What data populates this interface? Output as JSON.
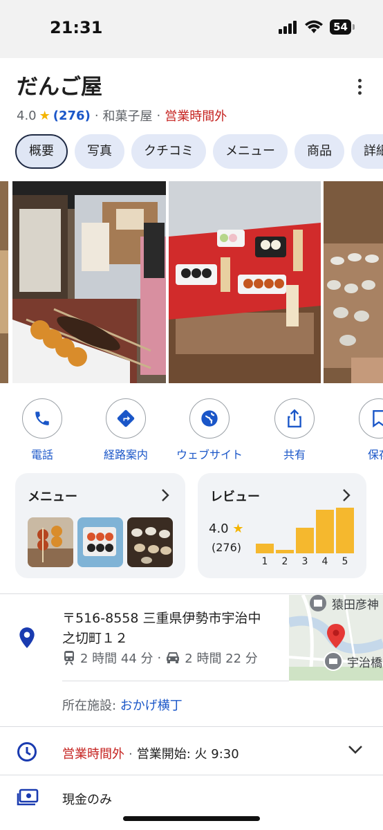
{
  "status": {
    "time": "21:31",
    "battery": "54"
  },
  "header": {
    "title": "だんご屋",
    "rating": "4.0",
    "review_count": "(276)",
    "category": "和菓子屋",
    "open_status": "営業時間外",
    "separator": "·"
  },
  "tabs": [
    "概要",
    "写真",
    "クチコミ",
    "メニュー",
    "商品",
    "詳細"
  ],
  "actions": [
    "電話",
    "経路案内",
    "ウェブサイト",
    "共有",
    "保存"
  ],
  "menu_card": {
    "title": "メニュー"
  },
  "review_card": {
    "title": "レビュー",
    "rating": "4.0",
    "count": "(276)",
    "distribution": [
      {
        "label": "1",
        "value": 0.2
      },
      {
        "label": "2",
        "value": 0.07
      },
      {
        "label": "3",
        "value": 0.55
      },
      {
        "label": "4",
        "value": 0.93
      },
      {
        "label": "5",
        "value": 0.97
      }
    ]
  },
  "address": {
    "text": "〒516-8558 三重県伊勢市宇治中之切町１２",
    "transit": "2 時間 44 分",
    "drive": "2 時間 22 分",
    "separator": "·"
  },
  "map": {
    "label_top": "猿田彦神",
    "label_bottom": "宇治橋"
  },
  "facility": {
    "label": "所在施設: ",
    "link": "おかげ横丁"
  },
  "hours": {
    "status": "営業時間外",
    "separator": "·",
    "next": "営業開始: 火 9:30"
  },
  "payment": {
    "text": "現金のみ"
  },
  "colors": {
    "accent": "#1a56c8",
    "closed": "#c5221f",
    "star": "#f4b400",
    "bar": "#f5b82e"
  }
}
